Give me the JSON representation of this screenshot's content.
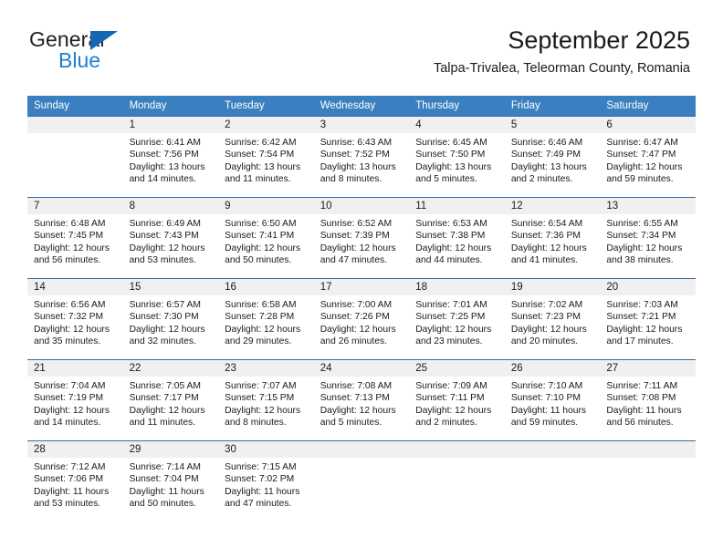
{
  "logo": {
    "primary_text": "General",
    "secondary_text": "Blue",
    "triangle_color": "#1567b2",
    "secondary_color": "#1b7fd4"
  },
  "header": {
    "title": "September 2025",
    "subtitle": "Talpa-Trivalea, Teleorman County, Romania"
  },
  "theme": {
    "header_row_bg": "#3a7fbf",
    "header_row_text": "#ffffff",
    "daynum_strip_bg": "#f0f0f0",
    "row_border": "#2e6da4"
  },
  "weekdays": [
    "Sunday",
    "Monday",
    "Tuesday",
    "Wednesday",
    "Thursday",
    "Friday",
    "Saturday"
  ],
  "weeks": [
    [
      {
        "day": "",
        "sunrise": "",
        "sunset": "",
        "daylight_line1": "",
        "daylight_line2": ""
      },
      {
        "day": "1",
        "sunrise": "Sunrise: 6:41 AM",
        "sunset": "Sunset: 7:56 PM",
        "daylight_line1": "Daylight: 13 hours",
        "daylight_line2": "and 14 minutes."
      },
      {
        "day": "2",
        "sunrise": "Sunrise: 6:42 AM",
        "sunset": "Sunset: 7:54 PM",
        "daylight_line1": "Daylight: 13 hours",
        "daylight_line2": "and 11 minutes."
      },
      {
        "day": "3",
        "sunrise": "Sunrise: 6:43 AM",
        "sunset": "Sunset: 7:52 PM",
        "daylight_line1": "Daylight: 13 hours",
        "daylight_line2": "and 8 minutes."
      },
      {
        "day": "4",
        "sunrise": "Sunrise: 6:45 AM",
        "sunset": "Sunset: 7:50 PM",
        "daylight_line1": "Daylight: 13 hours",
        "daylight_line2": "and 5 minutes."
      },
      {
        "day": "5",
        "sunrise": "Sunrise: 6:46 AM",
        "sunset": "Sunset: 7:49 PM",
        "daylight_line1": "Daylight: 13 hours",
        "daylight_line2": "and 2 minutes."
      },
      {
        "day": "6",
        "sunrise": "Sunrise: 6:47 AM",
        "sunset": "Sunset: 7:47 PM",
        "daylight_line1": "Daylight: 12 hours",
        "daylight_line2": "and 59 minutes."
      }
    ],
    [
      {
        "day": "7",
        "sunrise": "Sunrise: 6:48 AM",
        "sunset": "Sunset: 7:45 PM",
        "daylight_line1": "Daylight: 12 hours",
        "daylight_line2": "and 56 minutes."
      },
      {
        "day": "8",
        "sunrise": "Sunrise: 6:49 AM",
        "sunset": "Sunset: 7:43 PM",
        "daylight_line1": "Daylight: 12 hours",
        "daylight_line2": "and 53 minutes."
      },
      {
        "day": "9",
        "sunrise": "Sunrise: 6:50 AM",
        "sunset": "Sunset: 7:41 PM",
        "daylight_line1": "Daylight: 12 hours",
        "daylight_line2": "and 50 minutes."
      },
      {
        "day": "10",
        "sunrise": "Sunrise: 6:52 AM",
        "sunset": "Sunset: 7:39 PM",
        "daylight_line1": "Daylight: 12 hours",
        "daylight_line2": "and 47 minutes."
      },
      {
        "day": "11",
        "sunrise": "Sunrise: 6:53 AM",
        "sunset": "Sunset: 7:38 PM",
        "daylight_line1": "Daylight: 12 hours",
        "daylight_line2": "and 44 minutes."
      },
      {
        "day": "12",
        "sunrise": "Sunrise: 6:54 AM",
        "sunset": "Sunset: 7:36 PM",
        "daylight_line1": "Daylight: 12 hours",
        "daylight_line2": "and 41 minutes."
      },
      {
        "day": "13",
        "sunrise": "Sunrise: 6:55 AM",
        "sunset": "Sunset: 7:34 PM",
        "daylight_line1": "Daylight: 12 hours",
        "daylight_line2": "and 38 minutes."
      }
    ],
    [
      {
        "day": "14",
        "sunrise": "Sunrise: 6:56 AM",
        "sunset": "Sunset: 7:32 PM",
        "daylight_line1": "Daylight: 12 hours",
        "daylight_line2": "and 35 minutes."
      },
      {
        "day": "15",
        "sunrise": "Sunrise: 6:57 AM",
        "sunset": "Sunset: 7:30 PM",
        "daylight_line1": "Daylight: 12 hours",
        "daylight_line2": "and 32 minutes."
      },
      {
        "day": "16",
        "sunrise": "Sunrise: 6:58 AM",
        "sunset": "Sunset: 7:28 PM",
        "daylight_line1": "Daylight: 12 hours",
        "daylight_line2": "and 29 minutes."
      },
      {
        "day": "17",
        "sunrise": "Sunrise: 7:00 AM",
        "sunset": "Sunset: 7:26 PM",
        "daylight_line1": "Daylight: 12 hours",
        "daylight_line2": "and 26 minutes."
      },
      {
        "day": "18",
        "sunrise": "Sunrise: 7:01 AM",
        "sunset": "Sunset: 7:25 PM",
        "daylight_line1": "Daylight: 12 hours",
        "daylight_line2": "and 23 minutes."
      },
      {
        "day": "19",
        "sunrise": "Sunrise: 7:02 AM",
        "sunset": "Sunset: 7:23 PM",
        "daylight_line1": "Daylight: 12 hours",
        "daylight_line2": "and 20 minutes."
      },
      {
        "day": "20",
        "sunrise": "Sunrise: 7:03 AM",
        "sunset": "Sunset: 7:21 PM",
        "daylight_line1": "Daylight: 12 hours",
        "daylight_line2": "and 17 minutes."
      }
    ],
    [
      {
        "day": "21",
        "sunrise": "Sunrise: 7:04 AM",
        "sunset": "Sunset: 7:19 PM",
        "daylight_line1": "Daylight: 12 hours",
        "daylight_line2": "and 14 minutes."
      },
      {
        "day": "22",
        "sunrise": "Sunrise: 7:05 AM",
        "sunset": "Sunset: 7:17 PM",
        "daylight_line1": "Daylight: 12 hours",
        "daylight_line2": "and 11 minutes."
      },
      {
        "day": "23",
        "sunrise": "Sunrise: 7:07 AM",
        "sunset": "Sunset: 7:15 PM",
        "daylight_line1": "Daylight: 12 hours",
        "daylight_line2": "and 8 minutes."
      },
      {
        "day": "24",
        "sunrise": "Sunrise: 7:08 AM",
        "sunset": "Sunset: 7:13 PM",
        "daylight_line1": "Daylight: 12 hours",
        "daylight_line2": "and 5 minutes."
      },
      {
        "day": "25",
        "sunrise": "Sunrise: 7:09 AM",
        "sunset": "Sunset: 7:11 PM",
        "daylight_line1": "Daylight: 12 hours",
        "daylight_line2": "and 2 minutes."
      },
      {
        "day": "26",
        "sunrise": "Sunrise: 7:10 AM",
        "sunset": "Sunset: 7:10 PM",
        "daylight_line1": "Daylight: 11 hours",
        "daylight_line2": "and 59 minutes."
      },
      {
        "day": "27",
        "sunrise": "Sunrise: 7:11 AM",
        "sunset": "Sunset: 7:08 PM",
        "daylight_line1": "Daylight: 11 hours",
        "daylight_line2": "and 56 minutes."
      }
    ],
    [
      {
        "day": "28",
        "sunrise": "Sunrise: 7:12 AM",
        "sunset": "Sunset: 7:06 PM",
        "daylight_line1": "Daylight: 11 hours",
        "daylight_line2": "and 53 minutes."
      },
      {
        "day": "29",
        "sunrise": "Sunrise: 7:14 AM",
        "sunset": "Sunset: 7:04 PM",
        "daylight_line1": "Daylight: 11 hours",
        "daylight_line2": "and 50 minutes."
      },
      {
        "day": "30",
        "sunrise": "Sunrise: 7:15 AM",
        "sunset": "Sunset: 7:02 PM",
        "daylight_line1": "Daylight: 11 hours",
        "daylight_line2": "and 47 minutes."
      },
      {
        "day": "",
        "sunrise": "",
        "sunset": "",
        "daylight_line1": "",
        "daylight_line2": ""
      },
      {
        "day": "",
        "sunrise": "",
        "sunset": "",
        "daylight_line1": "",
        "daylight_line2": ""
      },
      {
        "day": "",
        "sunrise": "",
        "sunset": "",
        "daylight_line1": "",
        "daylight_line2": ""
      },
      {
        "day": "",
        "sunrise": "",
        "sunset": "",
        "daylight_line1": "",
        "daylight_line2": ""
      }
    ]
  ]
}
